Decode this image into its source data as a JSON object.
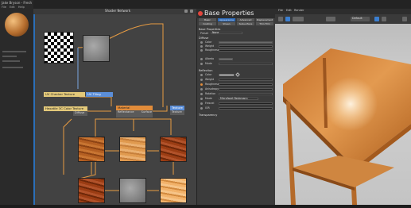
{
  "app": {
    "title": "Jake Bryson - Fresh",
    "menu": [
      "File",
      "Edit",
      "Help"
    ]
  },
  "node_editor": {
    "title": "Shader Network",
    "nodes": {
      "checker": "UV Checker Texture",
      "tiling": "UV Tiling",
      "hexa": "Hexatile 3C Color Texture",
      "material": "Material",
      "output": "Texture"
    },
    "ports": {
      "material_left": "Reflectance",
      "material_right": "Surface",
      "output_port": "Texture",
      "hexa_port": "Diffuse"
    }
  },
  "properties": {
    "title": "Base Properties",
    "tabs_row1": [
      "Basic",
      "Appearance",
      "Advanced",
      "Displacement"
    ],
    "tabs_row2": [
      "Coating",
      "Sheen",
      "Subsurface",
      "Thin Film"
    ],
    "header_label": "Base Properties",
    "preset_label": "Preset",
    "preset_value": "None",
    "sections": {
      "diffuse": "Diffuse",
      "reflection": "Reflection",
      "transparency": "Transparency"
    },
    "diffuse_rows": [
      "Color",
      "Weight",
      "Roughness",
      "Albedo",
      "Mode"
    ],
    "reflection_rows": [
      "Color",
      "Weight",
      "Roughness",
      "Anisotropy",
      "Rotation",
      "Mode",
      "Fresnel",
      "IOR"
    ],
    "mode_value": "Microfacet Beckmann"
  },
  "viewport": {
    "menu": [
      "File",
      "Edit",
      "Render"
    ],
    "camera_label": "Default",
    "colors": {
      "background": "#c7c7c7",
      "wood": "#d98a3a",
      "wood_dark": "#a85b1e"
    }
  },
  "colors": {
    "accent": "#2e6cbd",
    "close": "#e2453c",
    "editor_bg": "#424242",
    "node_yellow": "#e3c97a",
    "node_blue": "#5b8ed8",
    "node_orange": "#e28c3a"
  }
}
